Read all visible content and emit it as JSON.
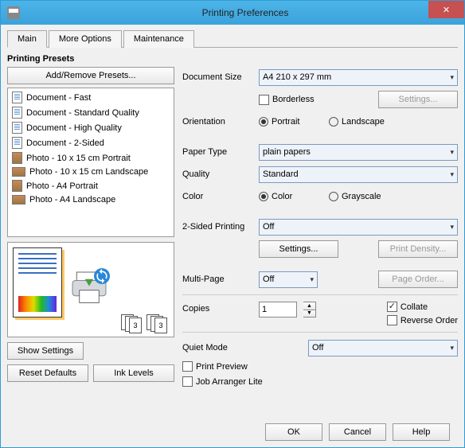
{
  "titlebar": {
    "title": "Printing Preferences"
  },
  "tabs": {
    "main": "Main",
    "more": "More Options",
    "maint": "Maintenance"
  },
  "presets": {
    "title": "Printing Presets",
    "add_remove": "Add/Remove Presets...",
    "items": [
      "Document - Fast",
      "Document - Standard Quality",
      "Document - High Quality",
      "Document - 2-Sided",
      "Photo - 10 x 15 cm Portrait",
      "Photo - 10 x 15 cm Landscape",
      "Photo - A4 Portrait",
      "Photo - A4 Landscape"
    ]
  },
  "left_buttons": {
    "show_settings": "Show Settings",
    "reset_defaults": "Reset Defaults",
    "ink_levels": "Ink Levels"
  },
  "form": {
    "doc_size_label": "Document Size",
    "doc_size_value": "A4 210 x 297 mm",
    "borderless_label": "Borderless",
    "settings_btn": "Settings...",
    "orientation_label": "Orientation",
    "portrait": "Portrait",
    "landscape": "Landscape",
    "paper_type_label": "Paper Type",
    "paper_type_value": "plain papers",
    "quality_label": "Quality",
    "quality_value": "Standard",
    "color_label": "Color",
    "color_opt": "Color",
    "grayscale_opt": "Grayscale",
    "two_sided_label": "2-Sided Printing",
    "two_sided_value": "Off",
    "print_density_btn": "Print Density...",
    "multipage_label": "Multi-Page",
    "multipage_value": "Off",
    "page_order_btn": "Page Order...",
    "copies_label": "Copies",
    "copies_value": "1",
    "collate_label": "Collate",
    "reverse_label": "Reverse Order",
    "quiet_label": "Quiet Mode",
    "quiet_value": "Off",
    "print_preview": "Print Preview",
    "job_arranger": "Job Arranger Lite"
  },
  "footer": {
    "ok": "OK",
    "cancel": "Cancel",
    "help": "Help"
  }
}
